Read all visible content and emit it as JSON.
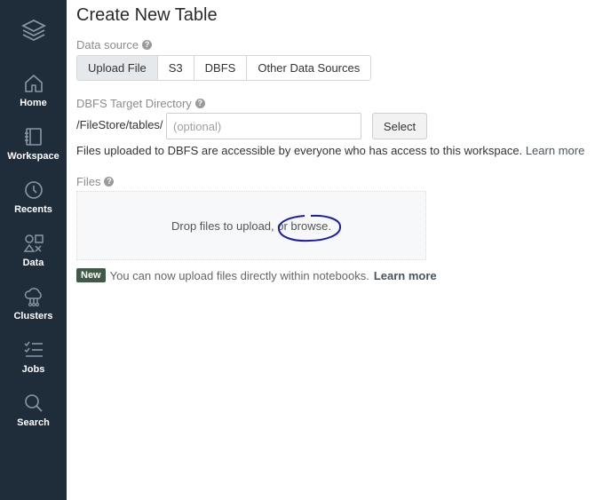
{
  "page": {
    "title": "Create New Table"
  },
  "sidebar": {
    "logo_icon": "databricks-stack-icon",
    "items": [
      {
        "label": "Home",
        "icon": "home-icon"
      },
      {
        "label": "Workspace",
        "icon": "workspace-icon"
      },
      {
        "label": "Recents",
        "icon": "clock-icon"
      },
      {
        "label": "Data",
        "icon": "data-shapes-icon"
      },
      {
        "label": "Clusters",
        "icon": "cluster-cloud-icon"
      },
      {
        "label": "Jobs",
        "icon": "jobs-list-icon"
      },
      {
        "label": "Search",
        "icon": "search-icon"
      }
    ]
  },
  "data_source": {
    "label": "Data source",
    "tabs": [
      "Upload File",
      "S3",
      "DBFS",
      "Other Data Sources"
    ],
    "active_tab": "Upload File"
  },
  "target_dir": {
    "label": "DBFS Target Directory",
    "prefix": "/FileStore/tables/",
    "placeholder": "(optional)",
    "value": "",
    "select_label": "Select",
    "note": "Files uploaded to DBFS are accessible by everyone who has access to this workspace.",
    "learn_more": "Learn more"
  },
  "files": {
    "label": "Files",
    "drop_text": "Drop files to upload,",
    "browse_text": "or browse."
  },
  "new_notice": {
    "badge": "New",
    "text": "You can now upload files directly within notebooks.",
    "learn_more": "Learn more"
  },
  "colors": {
    "sidebar_bg": "#1f2d3a",
    "annotation": "#1c1ca8",
    "badge_bg": "#3f5a45"
  }
}
